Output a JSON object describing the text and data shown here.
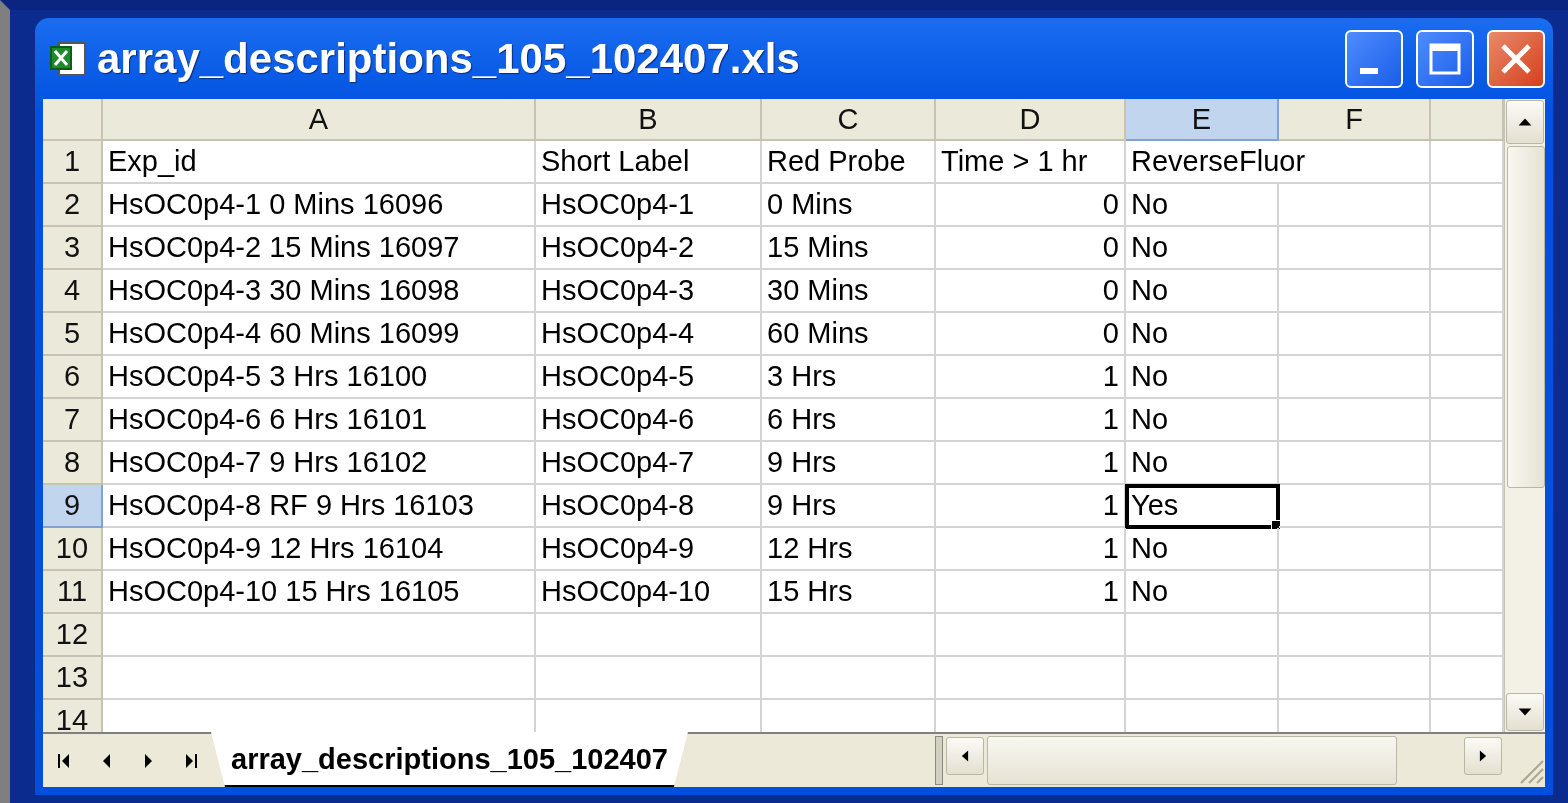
{
  "window": {
    "title": "array_descriptions_105_102407.xls"
  },
  "columns": [
    {
      "label": "A",
      "selected": false
    },
    {
      "label": "B",
      "selected": false
    },
    {
      "label": "C",
      "selected": false
    },
    {
      "label": "D",
      "selected": false,
      "numeric": true
    },
    {
      "label": "E",
      "selected": true
    },
    {
      "label": "F",
      "selected": false
    }
  ],
  "rows": [
    {
      "header": "1",
      "selected": false,
      "kind": "label",
      "cells": [
        "Exp_id",
        "Short Label",
        "Red Probe",
        "Time > 1 hr",
        "ReverseFluor"
      ]
    },
    {
      "header": "2",
      "selected": false,
      "kind": "data",
      "cells": [
        "HsOC0p4-1 0 Mins 16096",
        "HsOC0p4-1",
        "0 Mins",
        "0",
        "No"
      ]
    },
    {
      "header": "3",
      "selected": false,
      "kind": "data",
      "cells": [
        "HsOC0p4-2 15 Mins 16097",
        "HsOC0p4-2",
        "15 Mins",
        "0",
        "No"
      ]
    },
    {
      "header": "4",
      "selected": false,
      "kind": "data",
      "cells": [
        "HsOC0p4-3 30 Mins 16098",
        "HsOC0p4-3",
        "30 Mins",
        "0",
        "No"
      ]
    },
    {
      "header": "5",
      "selected": false,
      "kind": "data",
      "cells": [
        "HsOC0p4-4 60 Mins 16099",
        "HsOC0p4-4",
        "60 Mins",
        "0",
        "No"
      ]
    },
    {
      "header": "6",
      "selected": false,
      "kind": "data",
      "cells": [
        "HsOC0p4-5 3 Hrs 16100",
        "HsOC0p4-5",
        "3 Hrs",
        "1",
        "No"
      ]
    },
    {
      "header": "7",
      "selected": false,
      "kind": "data",
      "cells": [
        "HsOC0p4-6 6 Hrs 16101",
        "HsOC0p4-6",
        "6 Hrs",
        "1",
        "No"
      ]
    },
    {
      "header": "8",
      "selected": false,
      "kind": "data",
      "cells": [
        "HsOC0p4-7 9 Hrs 16102",
        "HsOC0p4-7",
        "9 Hrs",
        "1",
        "No"
      ]
    },
    {
      "header": "9",
      "selected": true,
      "kind": "data",
      "cells": [
        "HsOC0p4-8 RF 9 Hrs 16103",
        "HsOC0p4-8",
        "9 Hrs",
        "1",
        "Yes"
      ]
    },
    {
      "header": "10",
      "selected": false,
      "kind": "data",
      "cells": [
        "HsOC0p4-9 12 Hrs 16104",
        "HsOC0p4-9",
        "12 Hrs",
        "1",
        "No"
      ]
    },
    {
      "header": "11",
      "selected": false,
      "kind": "data",
      "cells": [
        "HsOC0p4-10 15 Hrs 16105",
        "HsOC0p4-10",
        "15 Hrs",
        "1",
        "No"
      ]
    },
    {
      "header": "12",
      "selected": false,
      "kind": "data",
      "cells": []
    },
    {
      "header": "13",
      "selected": false,
      "kind": "data",
      "cells": []
    },
    {
      "header": "14",
      "selected": false,
      "kind": "data",
      "cells": []
    }
  ],
  "sheet_tabs": [
    {
      "label": "array_descriptions_105_102407",
      "selected": true
    }
  ]
}
